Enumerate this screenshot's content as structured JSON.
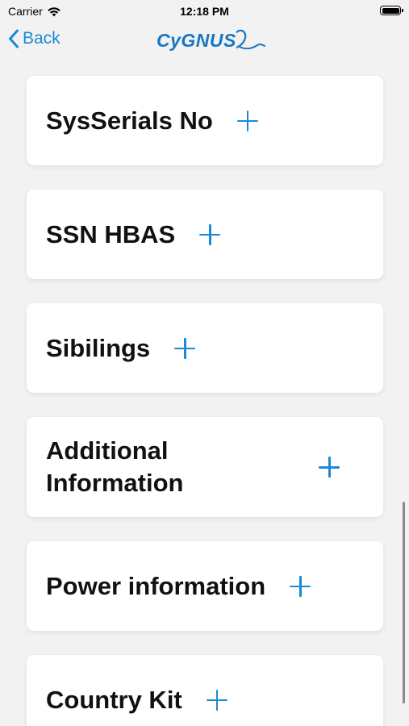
{
  "status_bar": {
    "carrier": "Carrier",
    "time": "12:18 PM",
    "wifi_icon": "wifi-icon",
    "battery_icon": "battery-icon"
  },
  "nav": {
    "back_label": "Back",
    "back_icon": "chevron-left-icon",
    "logo_text": "CyGNUS"
  },
  "colors": {
    "accent": "#1a8ad6",
    "logo": "#1976c2",
    "background": "#f2f2f2",
    "card": "#ffffff"
  },
  "sections": [
    {
      "label": "SysSerials No"
    },
    {
      "label": "SSN HBAS"
    },
    {
      "label": "Sibilings"
    },
    {
      "label": "Additional Information"
    },
    {
      "label": "Power information"
    },
    {
      "label": "Country Kit"
    }
  ]
}
